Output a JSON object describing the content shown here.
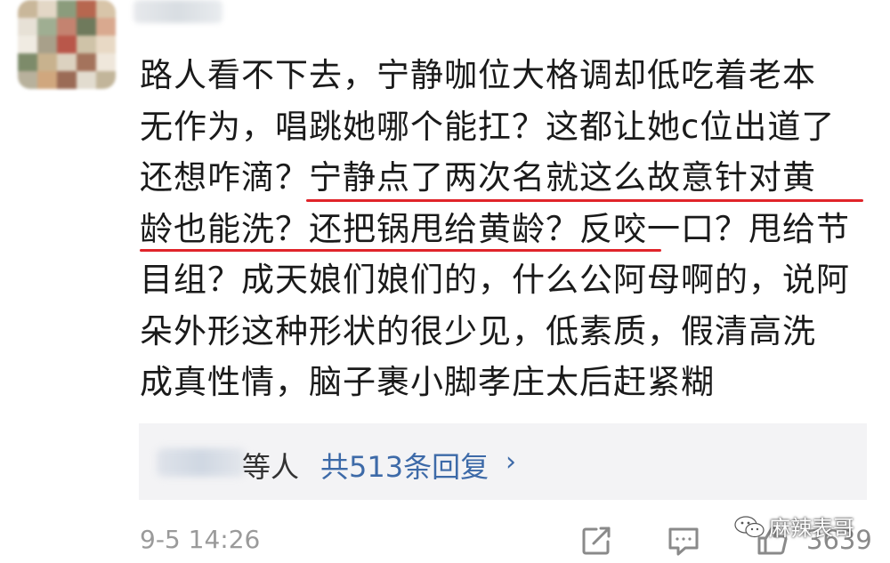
{
  "comment": {
    "text_lines": [
      "路人看不下去，宁静咖位大格调却低吃着老本",
      "无作为，唱跳她哪个能扛？这都让她c位出道了",
      "还想咋滴？宁静点了两次名就这么故意针对黄",
      "龄也能洗？还把锅甩给黄龄？反咬一口？甩给节",
      "目组？成天娘们娘们的，什么公阿母啊的，说阿",
      "朵外形这种形状的很少见，低素质，假清高洗",
      "成真性情，脑子裹小脚孝庄太后赶紧糊"
    ],
    "highlight_color": "#e0242a"
  },
  "replies": {
    "others_label": "等人",
    "link_label": "共513条回复",
    "chevron": "›",
    "link_color": "#3d6aa8"
  },
  "footer": {
    "timestamp": "9-5 14:26",
    "share_icon": "share-icon",
    "comment_icon": "comment-icon",
    "like_icon": "thumbs-up-icon",
    "like_count": "3639"
  },
  "watermark": {
    "text": "麻辣表哥"
  }
}
